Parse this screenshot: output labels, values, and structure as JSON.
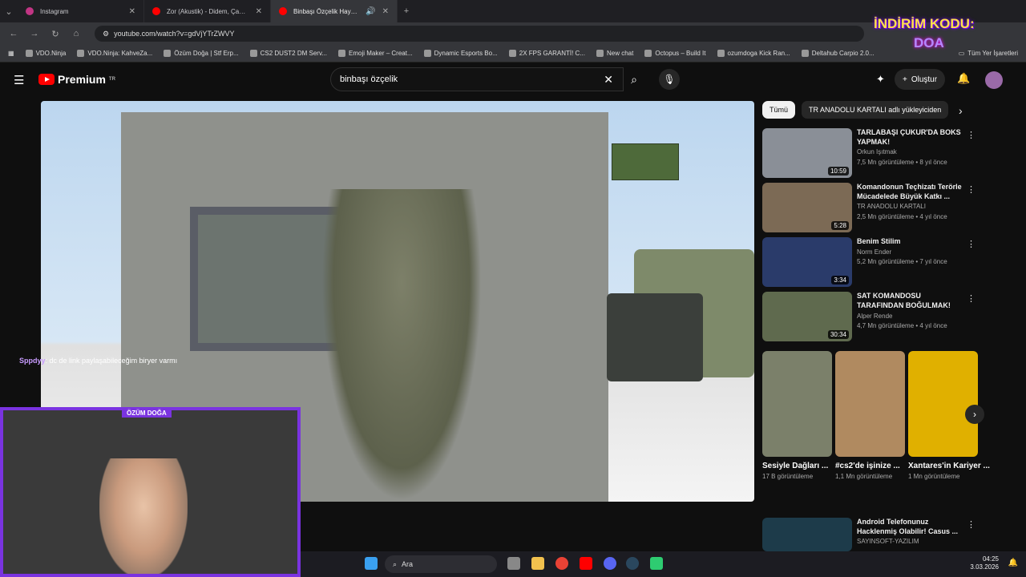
{
  "browser": {
    "tabs": [
      {
        "label": "Instagram",
        "color": "#c13584"
      },
      {
        "label": "Zor (Akustik) - Didem, Çağrı Er...",
        "color": "#ff0000"
      },
      {
        "label": "Binbaşı Özçelik Hayranları İ...",
        "color": "#ff0000"
      }
    ],
    "url": "youtube.com/watch?v=gdVjYTrZWVY",
    "bookmarks": [
      "VDO.Ninja",
      "VDO.Ninja: KahveZa...",
      "Özüm Doğa | Stf Erp...",
      "CS2 DUST2 DM Serv...",
      "Emoji Maker – Creat...",
      "Dynamic Esports Bo...",
      "2X FPS GARANTİ! C...",
      "New chat",
      "Octopus – Build It",
      "ozumdoga Kick Ran...",
      "Deltahub Carpio 2.0..."
    ],
    "all_bookmarks": "Tüm Yer İşaretleri"
  },
  "overlay": {
    "promo_line1": "İNDİRİM KODU:",
    "promo_line2": "DOA"
  },
  "youtube": {
    "logo_text": "Premium",
    "logo_sup": "TR",
    "search_value": "binbaşı özçelik",
    "create_label": "Oluştur"
  },
  "chat": {
    "user": "Sppdyy",
    "message": ": dc de link paylaşabileceğim biryer varmı"
  },
  "webcam": {
    "name": "ÖZÜM DOĞA"
  },
  "chips": [
    "Tümü",
    "TR ANADOLU KARTALI adlı yükleyiciden"
  ],
  "videos": [
    {
      "title": "TARLABAŞI ÇUKUR'DA BOKS YAPMAK!",
      "channel": "Orkun Işıtmak",
      "stats": "7,5 Mn görüntüleme • 8 yıl önce",
      "duration": "10:59",
      "color": "#8a8f97"
    },
    {
      "title": "Komandonun Teçhizatı Terörle Mücadelede Büyük Katkı ...",
      "channel": "TR ANADOLU KARTALI",
      "stats": "2,5 Mn görüntüleme • 4 yıl önce",
      "duration": "5:28",
      "color": "#7c6a55"
    },
    {
      "title": "Benim Stilim",
      "channel": "Norm Ender",
      "stats": "5,2 Mn görüntüleme • 7 yıl önce",
      "duration": "3:34",
      "color": "#2a3b6a"
    },
    {
      "title": "SAT KOMANDOSU TARAFINDAN BOĞULMAK! Yaşayan Efsanel...",
      "channel": "Alper Rende",
      "stats": "4,7 Mn görüntüleme • 4 yıl önce",
      "duration": "30:34",
      "color": "#5f6a4e"
    },
    {
      "title": "Android Telefonunuz Hacklenmiş Olabilir! Casus ...",
      "channel": "SAYINSOFT-YAZILIM",
      "stats": "",
      "duration": "",
      "color": "#1d3b4a"
    }
  ],
  "shorts": [
    {
      "title": "Sesiyle Dağları ...",
      "views": "17 B görüntüleme",
      "color": "#7b806a"
    },
    {
      "title": "#cs2'de işinize ...",
      "views": "1,1 Mn görüntüleme",
      "color": "#b08a60"
    },
    {
      "title": "Xantares'in Kariyer ...",
      "views": "1 Mn görüntüleme",
      "color": "#e0b000"
    }
  ],
  "taskbar": {
    "search": "Ara",
    "time": "04:25",
    "date": "3.03.2026"
  }
}
